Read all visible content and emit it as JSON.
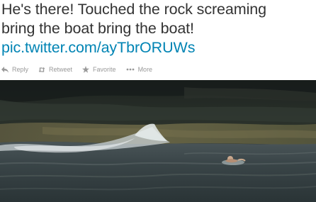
{
  "tweet": {
    "line1": "He's there! Touched the rock screaming",
    "line2": "bring the boat bring the boat!",
    "link": "pic.twitter.com/ayTbrORUWs"
  },
  "actions": [
    {
      "label": "Reply",
      "icon": "reply-icon"
    },
    {
      "label": "Retweet",
      "icon": "retweet-icon"
    },
    {
      "label": "Favorite",
      "icon": "star-icon"
    },
    {
      "label": "More",
      "icon": "more-dots-icon"
    }
  ],
  "colors": {
    "text": "#333333",
    "link": "#0084b4",
    "action": "#999999"
  }
}
